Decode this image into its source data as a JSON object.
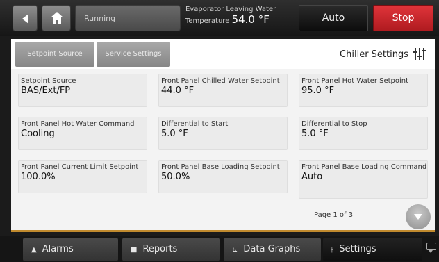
{
  "header": {
    "status_text": "Running",
    "evap_label_line1": "Evaporator Leaving Water",
    "evap_label_line2": "Temperature",
    "evap_value": "54.0 °F",
    "auto_label": "Auto",
    "stop_label": "Stop",
    "stop_color": "#d0272d"
  },
  "panel": {
    "tabs": [
      {
        "label": "Setpoint Source"
      },
      {
        "label": "Service Settings"
      }
    ],
    "title": "Chiller Settings",
    "title_icon": "settings-sliders-icon",
    "cells": [
      {
        "label": "Setpoint Source",
        "value": "BAS/Ext/FP"
      },
      {
        "label": "Front Panel Chilled Water Setpoint",
        "value": "44.0 °F"
      },
      {
        "label": "Front Panel Hot Water Setpoint",
        "value": "95.0 °F"
      },
      {
        "label": "Front Panel Hot Water Command",
        "value": "Cooling"
      },
      {
        "label": "Differential to Start",
        "value": "5.0 °F"
      },
      {
        "label": "Differential to Stop",
        "value": "5.0 °F"
      },
      {
        "label": "Front Panel Current Limit Setpoint",
        "value": "100.0%"
      },
      {
        "label": "Front Panel Base Loading Setpoint",
        "value": "50.0%"
      },
      {
        "label": "Front Panel Base Loading Command",
        "value": "Auto"
      }
    ],
    "page_info": "Page 1 of 3"
  },
  "nav": {
    "items": [
      {
        "label": "Alarms",
        "icon": "alarm-bell-icon"
      },
      {
        "label": "Reports",
        "icon": "report-icon"
      },
      {
        "label": "Data Graphs",
        "icon": "graph-icon"
      },
      {
        "label": "Settings",
        "icon": "settings-sliders-icon"
      }
    ],
    "accent": "#c08a2e"
  }
}
